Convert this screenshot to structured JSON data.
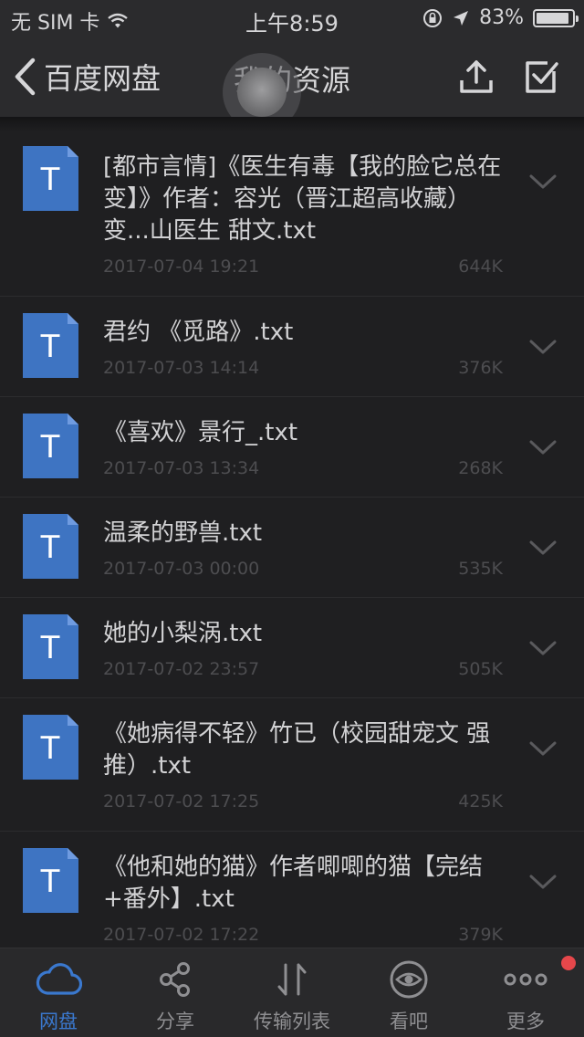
{
  "status_bar": {
    "carrier": "无 SIM 卡",
    "time": "上午8:59",
    "battery": "83%"
  },
  "nav": {
    "back_label": "百度网盘",
    "title": "我的资源"
  },
  "files": [
    {
      "name": "[都市言情]《医生有毒【我的脸它总在变】》作者：容光（晋江超高收藏）变...山医生 甜文.txt",
      "date": "2017-07-04 19:21",
      "size": "644K"
    },
    {
      "name": "君约 《觅路》.txt",
      "date": "2017-07-03 14:14",
      "size": "376K"
    },
    {
      "name": "《喜欢》景行_.txt",
      "date": "2017-07-03 13:34",
      "size": "268K"
    },
    {
      "name": "温柔的野兽.txt",
      "date": "2017-07-03 00:00",
      "size": "535K"
    },
    {
      "name": "她的小梨涡.txt",
      "date": "2017-07-02 23:57",
      "size": "505K"
    },
    {
      "name": "《她病得不轻》竹已（校园甜宠文 强推）.txt",
      "date": "2017-07-02 17:25",
      "size": "425K"
    },
    {
      "name": "《他和她的猫》作者唧唧的猫【完结+番外】.txt",
      "date": "2017-07-02 17:22",
      "size": "379K"
    }
  ],
  "file_icon_letter": "T",
  "tabs": [
    {
      "label": "网盘",
      "icon": "cloud-icon"
    },
    {
      "label": "分享",
      "icon": "share-icon"
    },
    {
      "label": "传输列表",
      "icon": "transfer-icon"
    },
    {
      "label": "看吧",
      "icon": "eye-icon"
    },
    {
      "label": "更多",
      "icon": "more-icon"
    }
  ],
  "colors": {
    "accent": "#3a78ce",
    "file_icon": "#3e74c2",
    "badge": "#e5474b"
  }
}
